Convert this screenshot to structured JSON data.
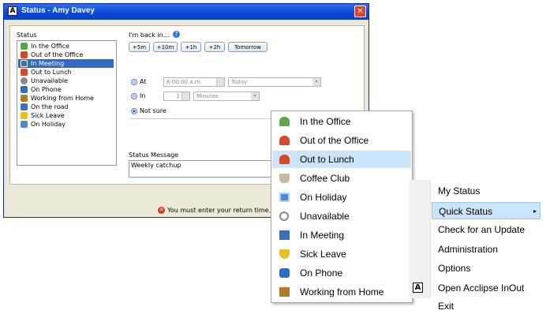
{
  "window": {
    "title": "Status - Amy Davey",
    "status_label": "Status",
    "status_items": [
      {
        "label": "In the Office",
        "icon": "person-green-icon",
        "color": "#5aa64a"
      },
      {
        "label": "Out of the Office",
        "icon": "person-red-icon",
        "color": "#d24a2a"
      },
      {
        "label": "In Meeting",
        "icon": "meeting-icon",
        "color": "#3a6fb0"
      },
      {
        "label": "Out to Lunch",
        "icon": "person-red-icon",
        "color": "#d24a2a"
      },
      {
        "label": "Unavailable",
        "icon": "clock-icon",
        "color": "#8a8a8a"
      },
      {
        "label": "On Phone",
        "icon": "phone-icon",
        "color": "#2f6fbf"
      },
      {
        "label": "Working from Home",
        "icon": "house-icon",
        "color": "#b07a2a"
      },
      {
        "label": "On the road",
        "icon": "car-icon",
        "color": "#3d6fc2"
      },
      {
        "label": "Sick Leave",
        "icon": "shield-icon",
        "color": "#e6c02a"
      },
      {
        "label": "On Holiday",
        "icon": "calendar-icon",
        "color": "#4f8ad0"
      }
    ],
    "back_label": "I'm back in...",
    "quick_buttons": [
      "+5m",
      "+10m",
      "+1h",
      "+2h",
      "Tomorrow"
    ],
    "at_label": "At",
    "at_time": "8:00:00 a.m.",
    "at_day": "Today",
    "in_label": "In",
    "in_value": "1",
    "in_unit": "Minutes",
    "not_sure_label": "Not sure",
    "message_label": "Status Message",
    "message_value": "Weekly catchup",
    "error_text": "You must enter your return time."
  },
  "quick_status_menu": [
    {
      "label": "In the Office",
      "icon": "person-green-icon",
      "color": "#5aa64a"
    },
    {
      "label": "Out of the Office",
      "icon": "person-red-icon",
      "color": "#d24a2a"
    },
    {
      "label": "Out to Lunch",
      "icon": "person-red-icon",
      "color": "#d24a2a"
    },
    {
      "label": "Coffee Club",
      "icon": "coffee-cup-icon",
      "color": "#c9b9a4"
    },
    {
      "label": "On Holiday",
      "icon": "calendar-icon",
      "color": "#4f8ad0"
    },
    {
      "label": "Unavailable",
      "icon": "clock-icon",
      "color": "#8a8a8a"
    },
    {
      "label": "In Meeting",
      "icon": "meeting-icon",
      "color": "#3a6fb0"
    },
    {
      "label": "Sick Leave",
      "icon": "shield-icon",
      "color": "#e6c02a"
    },
    {
      "label": "On Phone",
      "icon": "phone-icon",
      "color": "#2f6fbf"
    },
    {
      "label": "Working from Home",
      "icon": "house-icon",
      "color": "#b07a2a"
    }
  ],
  "main_menu": [
    {
      "label": "My Status"
    },
    {
      "label": "Quick Status"
    },
    {
      "label": "Check for an Update"
    },
    {
      "label": "Administration"
    },
    {
      "label": "Options"
    },
    {
      "label": "Open Acclipse InOut"
    },
    {
      "label": "Exit"
    }
  ],
  "app_logo_letter": "A",
  "help_glyph": "?",
  "close_glyph": "✕",
  "error_glyph": "✕",
  "submenu_arrow": "▸"
}
